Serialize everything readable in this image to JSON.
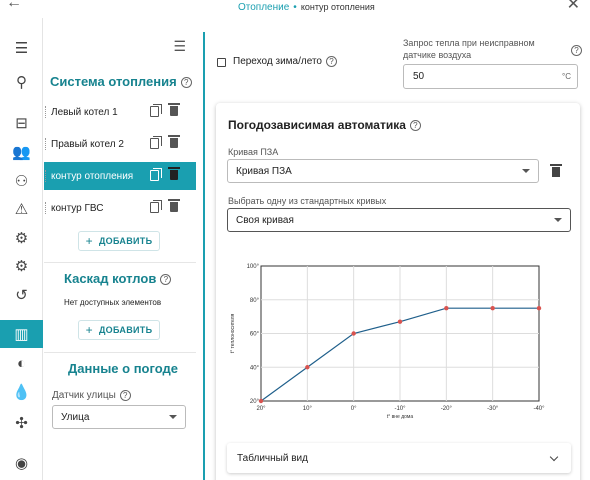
{
  "breadcrumb": {
    "parent": "Отопление",
    "current": "контур отопления"
  },
  "sidebar": {
    "heating_title": "Система отопления",
    "items": [
      {
        "label": "Левый котел 1"
      },
      {
        "label": "Правый котел 2"
      },
      {
        "label": "контур отопления"
      },
      {
        "label": "контур ГВС"
      }
    ],
    "add_label": "ДОБАВИТЬ",
    "cascade_title": "Каскад котлов",
    "cascade_empty": "Нет доступных элементов",
    "weather_title": "Данные о погоде",
    "street_sensor_label": "Датчик улицы",
    "street_sensor_value": "Улица"
  },
  "main": {
    "season_switch_label": "Переход зима/лето",
    "heat_request_label": "Запрос тепла при неисправном датчике воздуха",
    "heat_request_value": "50",
    "heat_request_unit": "°C",
    "card": {
      "title": "Погодозависимая автоматика",
      "curve_label": "Кривая ПЗА",
      "curve_value": "Кривая ПЗА",
      "standard_label": "Выбрать одну из стандартных кривых",
      "standard_value": "Своя кривая",
      "table_view_label": "Табличный вид"
    }
  },
  "colors": {
    "accent": "#1a9fb0",
    "line": "#1f5f8b",
    "point": "#d9534f"
  },
  "chart_data": {
    "type": "line",
    "xlabel": "t° вне дома",
    "ylabel": "t° теплоносителя",
    "x_tick_labels": [
      "20°",
      "10°",
      "0°",
      "-10°",
      "-20°",
      "-30°",
      "-40°"
    ],
    "y_tick_labels": [
      "20°",
      "40°",
      "60°",
      "80°",
      "100°"
    ],
    "ylim": [
      20,
      100
    ],
    "x": [
      20,
      10,
      0,
      -10,
      -20,
      -30,
      -40
    ],
    "series": [
      {
        "values": [
          20,
          40,
          60,
          67,
          75,
          75,
          75
        ]
      }
    ],
    "grid": true
  }
}
